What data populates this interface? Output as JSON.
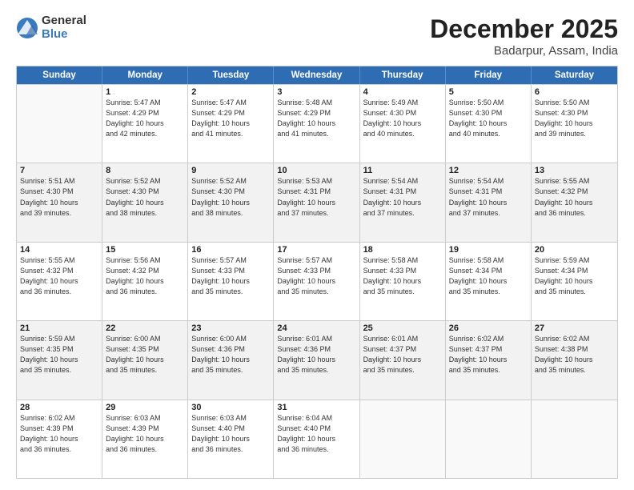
{
  "logo": {
    "general": "General",
    "blue": "Blue"
  },
  "title": "December 2025",
  "subtitle": "Badarpur, Assam, India",
  "header_days": [
    "Sunday",
    "Monday",
    "Tuesday",
    "Wednesday",
    "Thursday",
    "Friday",
    "Saturday"
  ],
  "rows": [
    [
      {
        "day": "",
        "info": ""
      },
      {
        "day": "1",
        "info": "Sunrise: 5:47 AM\nSunset: 4:29 PM\nDaylight: 10 hours\nand 42 minutes."
      },
      {
        "day": "2",
        "info": "Sunrise: 5:47 AM\nSunset: 4:29 PM\nDaylight: 10 hours\nand 41 minutes."
      },
      {
        "day": "3",
        "info": "Sunrise: 5:48 AM\nSunset: 4:29 PM\nDaylight: 10 hours\nand 41 minutes."
      },
      {
        "day": "4",
        "info": "Sunrise: 5:49 AM\nSunset: 4:30 PM\nDaylight: 10 hours\nand 40 minutes."
      },
      {
        "day": "5",
        "info": "Sunrise: 5:50 AM\nSunset: 4:30 PM\nDaylight: 10 hours\nand 40 minutes."
      },
      {
        "day": "6",
        "info": "Sunrise: 5:50 AM\nSunset: 4:30 PM\nDaylight: 10 hours\nand 39 minutes."
      }
    ],
    [
      {
        "day": "7",
        "info": "Sunrise: 5:51 AM\nSunset: 4:30 PM\nDaylight: 10 hours\nand 39 minutes."
      },
      {
        "day": "8",
        "info": "Sunrise: 5:52 AM\nSunset: 4:30 PM\nDaylight: 10 hours\nand 38 minutes."
      },
      {
        "day": "9",
        "info": "Sunrise: 5:52 AM\nSunset: 4:30 PM\nDaylight: 10 hours\nand 38 minutes."
      },
      {
        "day": "10",
        "info": "Sunrise: 5:53 AM\nSunset: 4:31 PM\nDaylight: 10 hours\nand 37 minutes."
      },
      {
        "day": "11",
        "info": "Sunrise: 5:54 AM\nSunset: 4:31 PM\nDaylight: 10 hours\nand 37 minutes."
      },
      {
        "day": "12",
        "info": "Sunrise: 5:54 AM\nSunset: 4:31 PM\nDaylight: 10 hours\nand 37 minutes."
      },
      {
        "day": "13",
        "info": "Sunrise: 5:55 AM\nSunset: 4:32 PM\nDaylight: 10 hours\nand 36 minutes."
      }
    ],
    [
      {
        "day": "14",
        "info": "Sunrise: 5:55 AM\nSunset: 4:32 PM\nDaylight: 10 hours\nand 36 minutes."
      },
      {
        "day": "15",
        "info": "Sunrise: 5:56 AM\nSunset: 4:32 PM\nDaylight: 10 hours\nand 36 minutes."
      },
      {
        "day": "16",
        "info": "Sunrise: 5:57 AM\nSunset: 4:33 PM\nDaylight: 10 hours\nand 35 minutes."
      },
      {
        "day": "17",
        "info": "Sunrise: 5:57 AM\nSunset: 4:33 PM\nDaylight: 10 hours\nand 35 minutes."
      },
      {
        "day": "18",
        "info": "Sunrise: 5:58 AM\nSunset: 4:33 PM\nDaylight: 10 hours\nand 35 minutes."
      },
      {
        "day": "19",
        "info": "Sunrise: 5:58 AM\nSunset: 4:34 PM\nDaylight: 10 hours\nand 35 minutes."
      },
      {
        "day": "20",
        "info": "Sunrise: 5:59 AM\nSunset: 4:34 PM\nDaylight: 10 hours\nand 35 minutes."
      }
    ],
    [
      {
        "day": "21",
        "info": "Sunrise: 5:59 AM\nSunset: 4:35 PM\nDaylight: 10 hours\nand 35 minutes."
      },
      {
        "day": "22",
        "info": "Sunrise: 6:00 AM\nSunset: 4:35 PM\nDaylight: 10 hours\nand 35 minutes."
      },
      {
        "day": "23",
        "info": "Sunrise: 6:00 AM\nSunset: 4:36 PM\nDaylight: 10 hours\nand 35 minutes."
      },
      {
        "day": "24",
        "info": "Sunrise: 6:01 AM\nSunset: 4:36 PM\nDaylight: 10 hours\nand 35 minutes."
      },
      {
        "day": "25",
        "info": "Sunrise: 6:01 AM\nSunset: 4:37 PM\nDaylight: 10 hours\nand 35 minutes."
      },
      {
        "day": "26",
        "info": "Sunrise: 6:02 AM\nSunset: 4:37 PM\nDaylight: 10 hours\nand 35 minutes."
      },
      {
        "day": "27",
        "info": "Sunrise: 6:02 AM\nSunset: 4:38 PM\nDaylight: 10 hours\nand 35 minutes."
      }
    ],
    [
      {
        "day": "28",
        "info": "Sunrise: 6:02 AM\nSunset: 4:39 PM\nDaylight: 10 hours\nand 36 minutes."
      },
      {
        "day": "29",
        "info": "Sunrise: 6:03 AM\nSunset: 4:39 PM\nDaylight: 10 hours\nand 36 minutes."
      },
      {
        "day": "30",
        "info": "Sunrise: 6:03 AM\nSunset: 4:40 PM\nDaylight: 10 hours\nand 36 minutes."
      },
      {
        "day": "31",
        "info": "Sunrise: 6:04 AM\nSunset: 4:40 PM\nDaylight: 10 hours\nand 36 minutes."
      },
      {
        "day": "",
        "info": ""
      },
      {
        "day": "",
        "info": ""
      },
      {
        "day": "",
        "info": ""
      }
    ]
  ]
}
